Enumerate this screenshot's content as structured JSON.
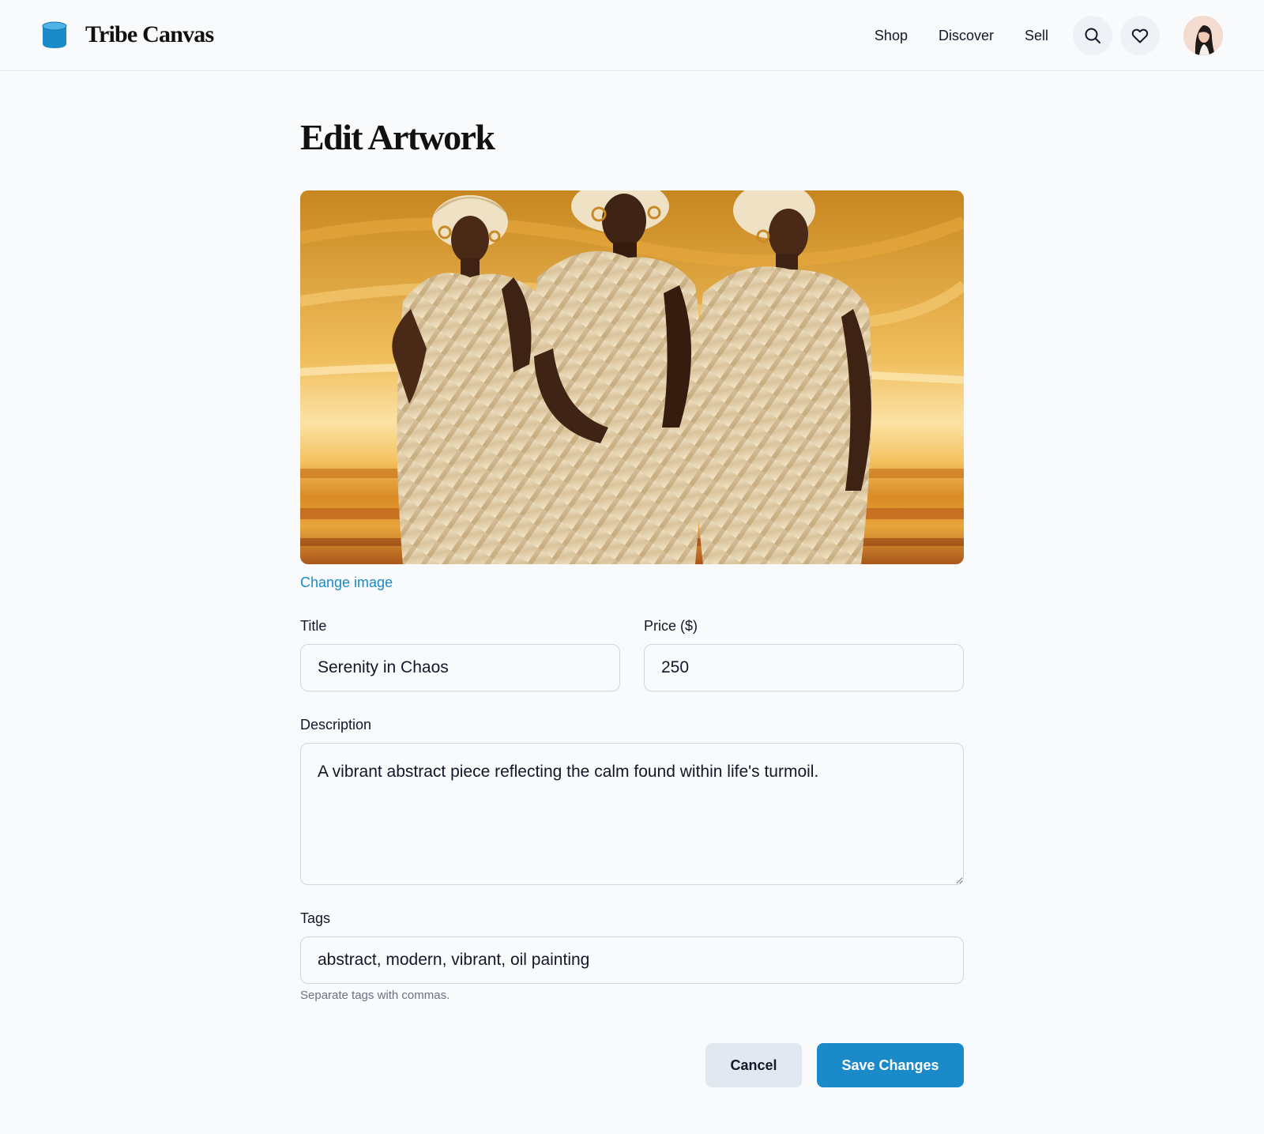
{
  "app": {
    "name": "Tribe Canvas",
    "brand_color": "#1b8ac9"
  },
  "nav": {
    "items": [
      {
        "label": "Shop"
      },
      {
        "label": "Discover"
      },
      {
        "label": "Sell"
      }
    ],
    "search_icon": "search-icon",
    "favorites_icon": "heart-icon",
    "avatar": "user-avatar"
  },
  "page": {
    "title": "Edit Artwork"
  },
  "artwork": {
    "image_description_icon": "artwork-image",
    "change_image_label": "Change image"
  },
  "form": {
    "title": {
      "label": "Title",
      "value": "Serenity in Chaos"
    },
    "price": {
      "label": "Price ($)",
      "value": "250"
    },
    "description": {
      "label": "Description",
      "value": "A vibrant abstract piece reflecting the calm found within life's turmoil."
    },
    "tags": {
      "label": "Tags",
      "value": "abstract, modern, vibrant, oil painting",
      "hint": "Separate tags with commas."
    }
  },
  "actions": {
    "cancel_label": "Cancel",
    "save_label": "Save Changes"
  }
}
